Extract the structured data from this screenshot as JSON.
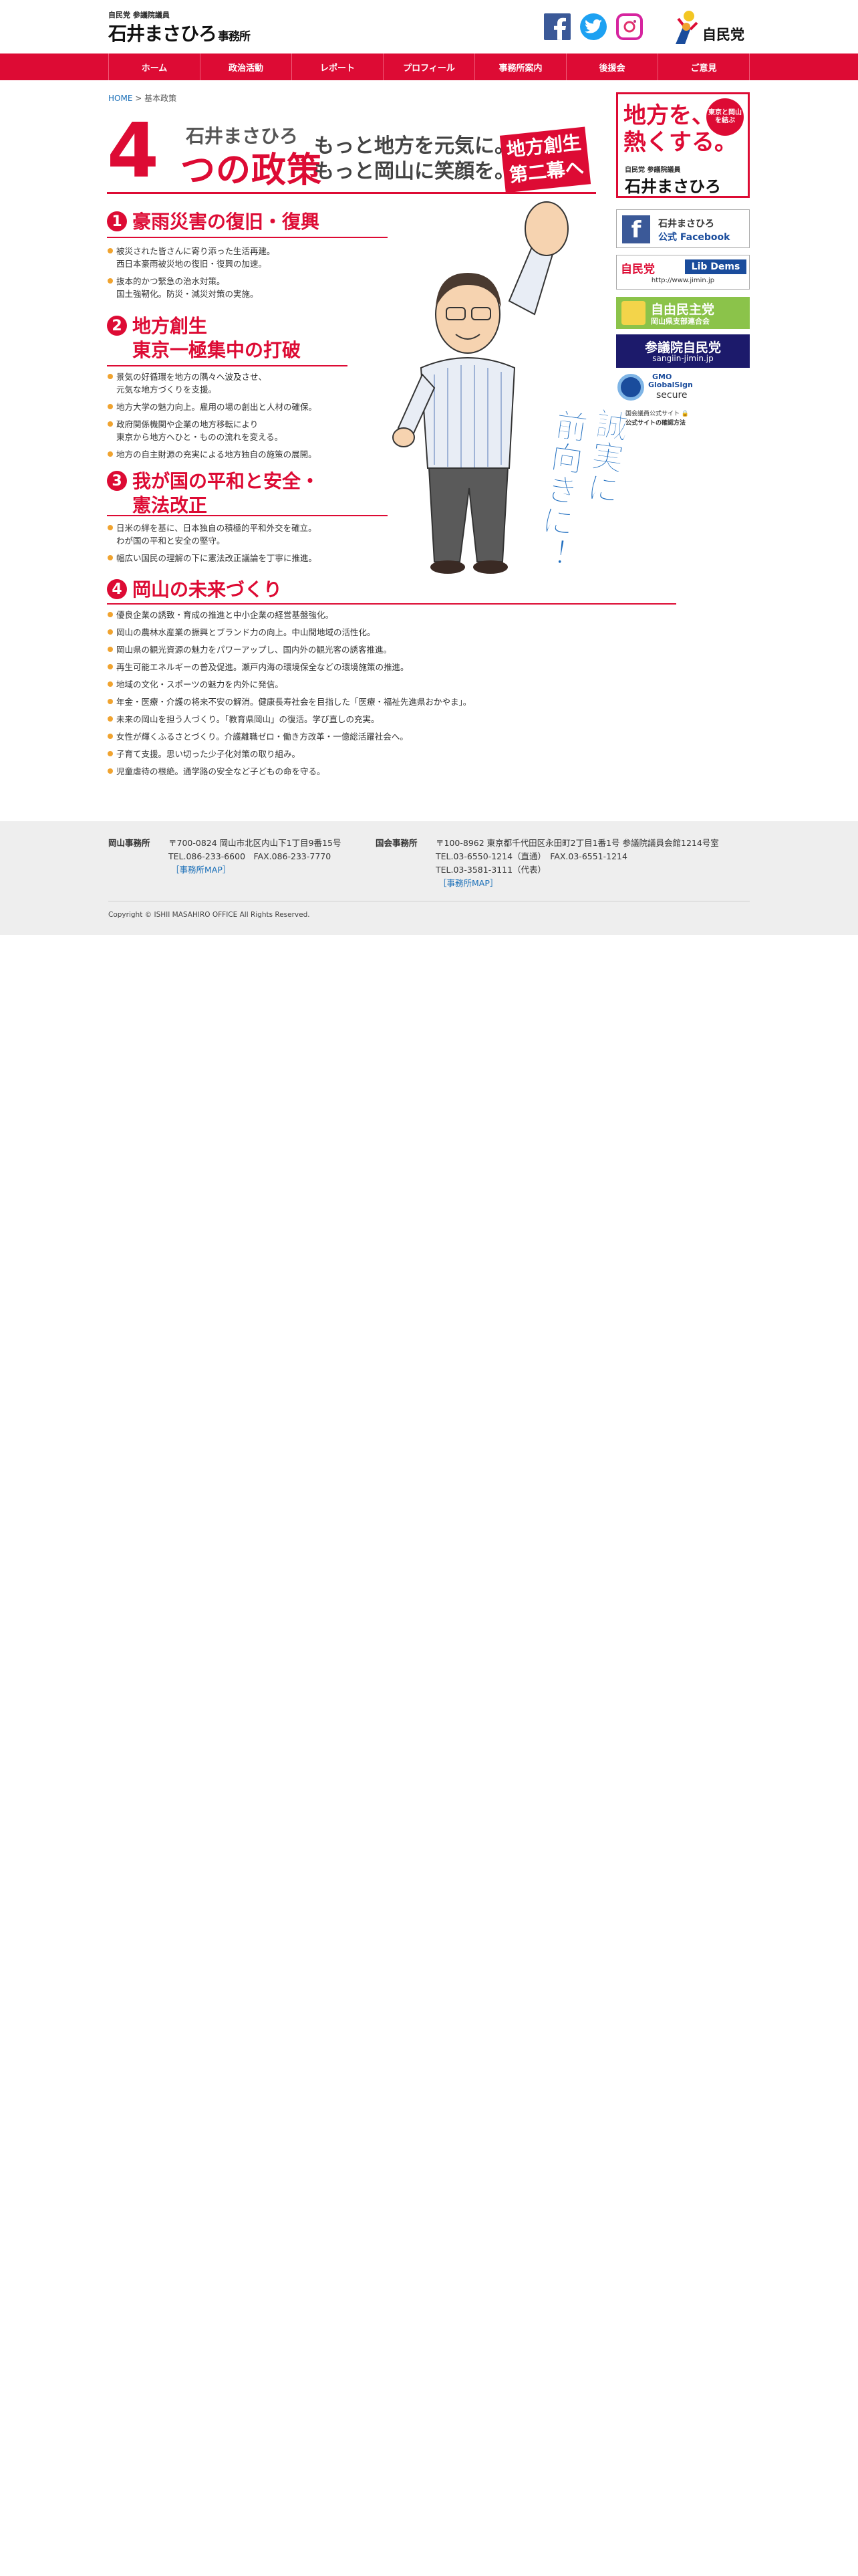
{
  "header": {
    "logo_small": "自民党 参議院議員",
    "logo_name": "石井まさひろ",
    "logo_suffix": "事務所",
    "party_logo_text": "自民党"
  },
  "nav": {
    "items": [
      "ホーム",
      "政治活動",
      "レポート",
      "プロフィール",
      "事務所案内",
      "後援会",
      "ご意見"
    ]
  },
  "breadcrumb": {
    "home": "HOME",
    "separator": ">",
    "current": "基本政策"
  },
  "title": {
    "number": "4",
    "name": "石井まさひろ",
    "main": "つの政策",
    "tagline_1": "もっと地方を元気に。",
    "tagline_2": "もっと岡山に笑顔を。",
    "badge_1": "地方創生",
    "badge_2": "第二幕へ"
  },
  "sections": [
    {
      "num": "1",
      "title": "豪雨災害の復旧・復興",
      "items": [
        "被災された皆さんに寄り添った生活再建。\n西日本豪雨被災地の復旧・復興の加速。",
        "抜本的かつ緊急の治水対策。\n国土強靭化。防災・減災対策の実施。"
      ]
    },
    {
      "num": "2",
      "title_1": "地方創生",
      "title_2": "東京一極集中の打破",
      "items": [
        "景気の好循環を地方の隅々へ波及させ、\n元気な地方づくりを支援。",
        "地方大学の魅力向上。雇用の場の創出と人材の確保。",
        "政府関係機関や企業の地方移転により\n東京から地方へひと・ものの流れを変える。",
        "地方の自主財源の充実による地方独自の施策の展開。"
      ]
    },
    {
      "num": "3",
      "title_1": "我が国の平和と安全・",
      "title_2": "憲法改正",
      "items": [
        "日米の絆を基に、日本独自の積極的平和外交を確立。\nわが国の平和と安全の堅守。",
        "幅広い国民の理解の下に憲法改正議論を丁寧に推進。"
      ]
    },
    {
      "num": "4",
      "title": "岡山の未来づくり",
      "items": [
        "優良企業の誘致・育成の推進と中小企業の経営基盤強化。",
        "岡山の農林水産業の振興とブランド力の向上。中山間地域の活性化。",
        "岡山県の観光資源の魅力をパワーアップし、国内外の観光客の誘客推進。",
        "再生可能エネルギーの普及促進。瀬戸内海の環境保全などの環境施策の推進。",
        "地域の文化・スポーツの魅力を内外に発信。",
        "年金・医療・介護の将来不安の解消。健康長寿社会を目指した「医療・福祉先進県おかやま」。",
        "未来の岡山を担う人づくり。「教育県岡山」の復活。学び直しの充実。",
        "女性が輝くふるさとづくり。介護離職ゼロ・働き方改革・一億総活躍社会へ。",
        "子育て支援。思い切った少子化対策の取り組み。",
        "児童虐待の根絶。通学路の安全など子どもの命を守る。"
      ]
    }
  ],
  "slogan": {
    "line_1": "誠実に",
    "line_2": "前向きに！"
  },
  "sidebar": {
    "atsuku_1": "地方を、",
    "atsuku_2": "熱くする。",
    "atsuku_badge": "東京と岡山を結ぶ",
    "atsuku_small": "自民党 参議院議員",
    "atsuku_name": "石井まさひろ",
    "fb_1": "石井まさひろ",
    "fb_2": "公式 Facebook",
    "lib_1": "自民党",
    "lib_2": "Lib Dems",
    "lib_url": "http://www.jimin.jp",
    "jimin_1": "自由民主党",
    "jimin_2": "岡山県支部連合会",
    "sangiin_1": "参議院自民党",
    "sangiin_2": "sangiin-jimin.jp",
    "gmo_1": "GMO",
    "gmo_2": "GlobalSign",
    "gmo_3": "secure",
    "gmo_4": "国会議員公式サイト 🔒",
    "gmo_5": "公式サイトの確認方法"
  },
  "footer": {
    "okayama_label": "岡山事務所",
    "okayama_addr": "〒700-0824 岡山市北区内山下1丁目9番15号",
    "okayama_tel": "TEL.086-233-6600　FAX.086-233-7770",
    "okayama_map": "［事務所MAP］",
    "kokkai_label": "国会事務所",
    "kokkai_addr": "〒100-8962 東京都千代田区永田町2丁目1番1号 参議院議員会館1214号室",
    "kokkai_tel_1": "TEL.03-6550-1214（直通）　FAX.03-6551-1214",
    "kokkai_tel_2": "TEL.03-3581-3111（代表）",
    "kokkai_map": "［事務所MAP］",
    "copyright": "Copyright © ISHII MASAHIRO OFFICE All Rights Reserved."
  },
  "colors": {
    "brand_red": "#dd0b34",
    "link_blue": "#1a6fb8",
    "bullet_orange": "#f0a32f",
    "slogan_blue": "#1c6cbf"
  }
}
